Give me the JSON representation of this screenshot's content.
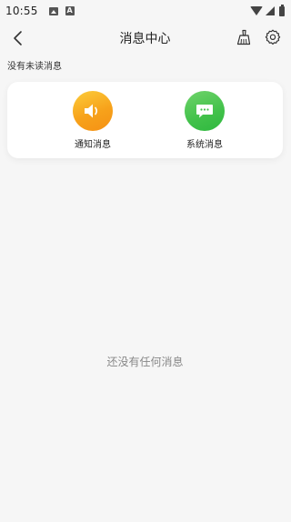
{
  "status_bar": {
    "time": "10:55"
  },
  "header": {
    "title": "消息中心"
  },
  "unread_note": "没有未读消息",
  "entries": [
    {
      "label": "通知消息",
      "icon": "speaker-icon",
      "color": "#f7a21b"
    },
    {
      "label": "系统消息",
      "icon": "chat-bubble-icon",
      "color": "#41c14a"
    }
  ],
  "empty_state": "还没有任何消息"
}
